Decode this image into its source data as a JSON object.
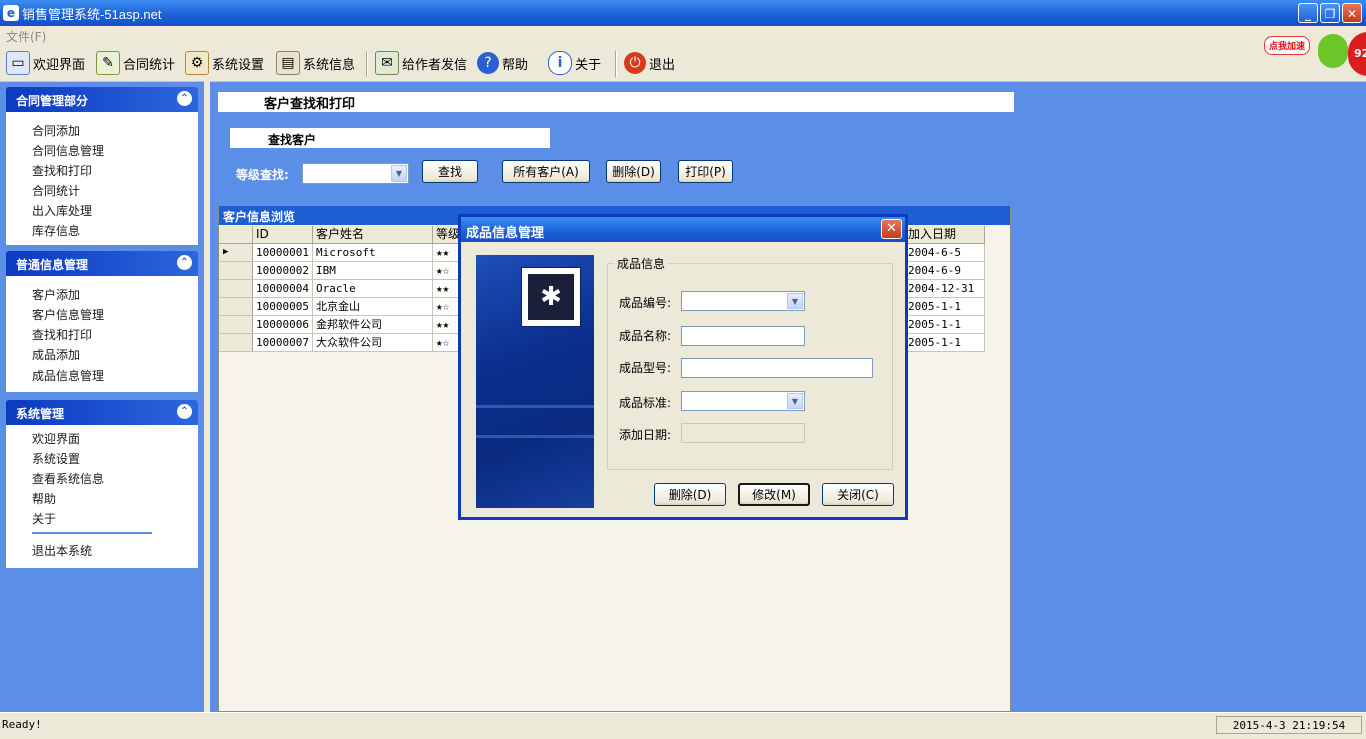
{
  "window": {
    "title": "销售管理系统-51asp.net",
    "minimize": "_",
    "maximize": "❐",
    "close": "✕"
  },
  "menu": {
    "file": "文件(F)"
  },
  "toolbar": {
    "welcome": "欢迎界面",
    "contract_stats": "合同统计",
    "settings": "系统设置",
    "sysinfo": "系统信息",
    "mail_author": "给作者发信",
    "help": "帮助",
    "about": "关于",
    "exit": "退出"
  },
  "speed_widget": {
    "label": "点我加速",
    "value": "92"
  },
  "nav": {
    "sections": [
      {
        "title": "合同管理部分",
        "items": [
          "合同添加",
          "合同信息管理",
          "查找和打印",
          "合同统计",
          "出入库处理",
          "库存信息"
        ]
      },
      {
        "title": "普通信息管理",
        "items": [
          "客户添加",
          "客户信息管理",
          "查找和打印",
          "成品添加",
          "成品信息管理"
        ]
      },
      {
        "title": "系统管理",
        "items": [
          "欢迎界面",
          "系统设置",
          "查看系统信息",
          "帮助",
          "关于"
        ],
        "footer_item": "退出本系统"
      }
    ]
  },
  "main": {
    "page_title": "客户查找和打印",
    "section_title": "查找客户",
    "level_label": "等级查找:",
    "level_value": "",
    "buttons": {
      "find": "查找",
      "all": "所有客户(A)",
      "delete": "删除(D)",
      "print": "打印(P)"
    }
  },
  "grid": {
    "caption": "客户信息浏览",
    "columns": [
      "ID",
      "客户姓名",
      "等级",
      "加入日期"
    ],
    "rows": [
      {
        "id": "10000001",
        "name": "Microsoft",
        "stars": "★★",
        "date": "2004-6-5",
        "current": true
      },
      {
        "id": "10000002",
        "name": "IBM",
        "stars": "★☆",
        "date": "2004-6-9"
      },
      {
        "id": "10000004",
        "name": "Oracle",
        "stars": "★★",
        "date": "2004-12-31"
      },
      {
        "id": "10000005",
        "name": "北京金山",
        "stars": "★☆",
        "date": "2005-1-1"
      },
      {
        "id": "10000006",
        "name": "金邦软件公司",
        "stars": "★★",
        "date": "2005-1-1"
      },
      {
        "id": "10000007",
        "name": "大众软件公司",
        "stars": "★☆",
        "date": "2005-1-1"
      }
    ],
    "current_marker": "▶"
  },
  "dialog": {
    "title": "成品信息管理",
    "group": "成品信息",
    "fields": {
      "code_label": "成品编号:",
      "code_value": "",
      "name_label": "成品名称:",
      "name_value": "",
      "model_label": "成品型号:",
      "model_value": "",
      "standard_label": "成品标准:",
      "standard_value": "",
      "date_label": "添加日期:",
      "date_value": ""
    },
    "buttons": {
      "delete": "删除(D)",
      "modify": "修改(M)",
      "close": "关闭(C)"
    }
  },
  "status": {
    "left": "Ready!",
    "right": "2015-4-3 21:19:54"
  }
}
